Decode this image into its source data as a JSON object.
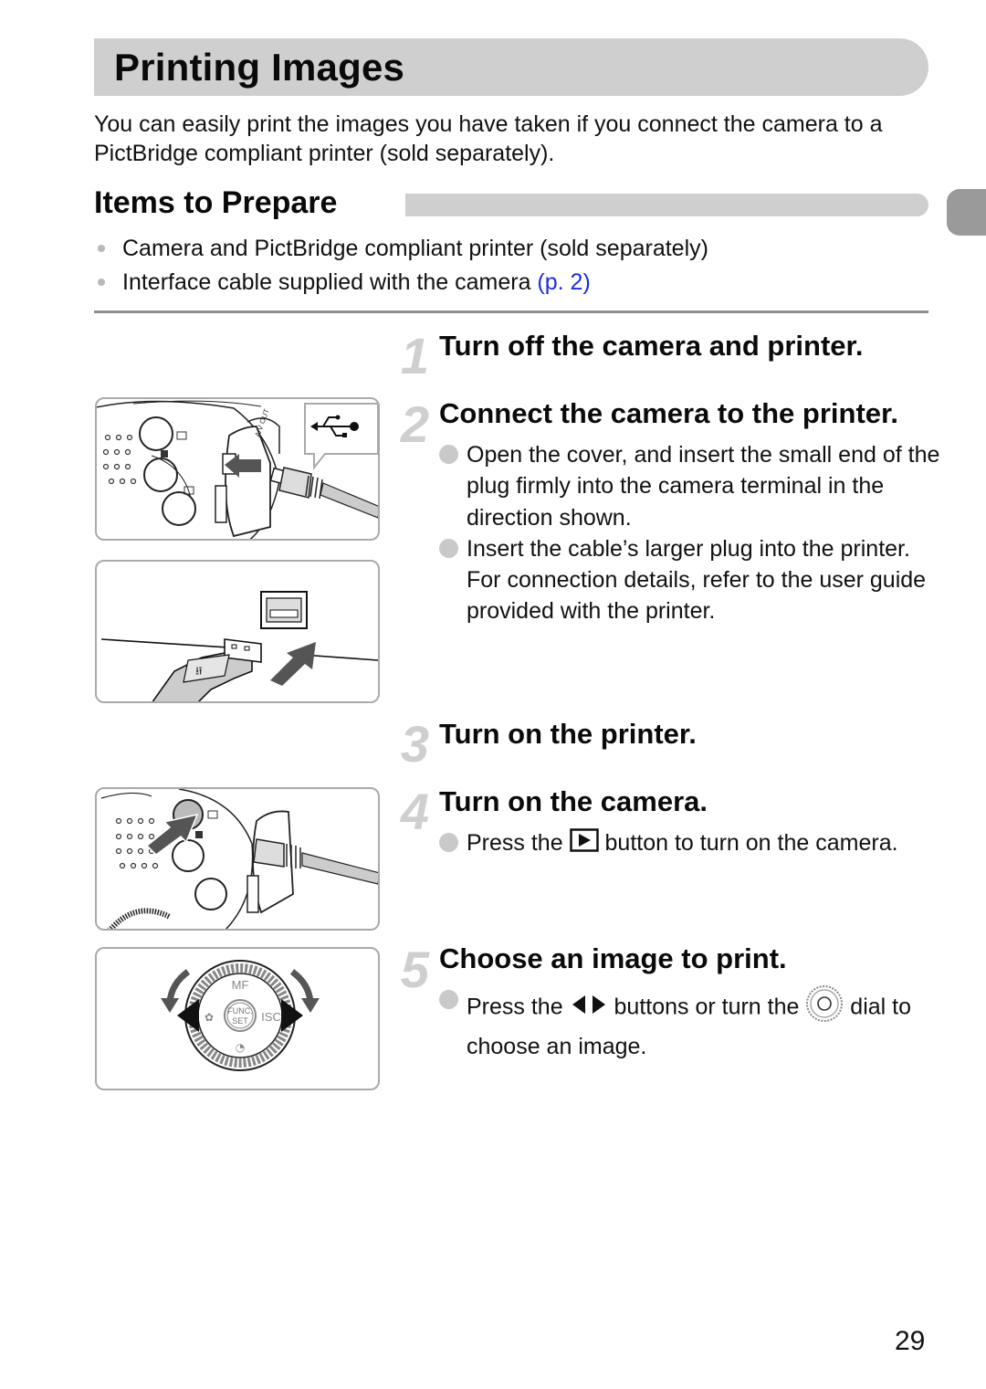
{
  "header": {
    "title": "Printing Images",
    "intro": "You can easily print the images you have taken if you connect the camera to a PictBridge compliant printer (sold separately)."
  },
  "items_to_prepare": {
    "heading": "Items to Prepare",
    "items": [
      {
        "text": "Camera and PictBridge compliant printer (sold separately)",
        "link": ""
      },
      {
        "text": "Interface cable supplied with the camera ",
        "link": "(p. 2)"
      }
    ]
  },
  "steps": [
    {
      "number": "1",
      "title": "Turn off the camera and printer.",
      "bullets": []
    },
    {
      "number": "2",
      "title": "Connect the camera to the printer.",
      "bullets": [
        "Open the cover, and insert the small end of the plug firmly into the camera terminal in the direction shown.",
        "Insert the cable’s larger plug into the printer. For connection details, refer to the user guide provided with the printer."
      ]
    },
    {
      "number": "3",
      "title": "Turn on the printer.",
      "bullets": []
    },
    {
      "number": "4",
      "title": "Turn on the camera.",
      "bullets": [
        {
          "before": "Press the ",
          "icon": "playback-button-icon",
          "after": " button to turn on the camera."
        }
      ]
    },
    {
      "number": "5",
      "title": "Choose an image to print.",
      "bullets": [
        {
          "before": "Press the ",
          "icon1": "left-right-arrows-icon",
          "middle": " buttons or turn the ",
          "icon2": "control-dial-icon",
          "after": " dial to choose an image."
        }
      ]
    }
  ],
  "figures": {
    "camera_terminal": {
      "label": "Camera USB terminal with plug insertion",
      "usb_symbol": "usb-icon",
      "terminal_label": "A/V OUT"
    },
    "printer_port": {
      "label": "USB plug into printer port"
    },
    "playback_button": {
      "label": "Press playback button"
    },
    "control_dial": {
      "label": "Control dial",
      "labels": {
        "top": "MF",
        "center_top": "FUNC.",
        "center_bottom": "SET",
        "right": "ISC"
      }
    }
  },
  "footer": {
    "page_number": "29"
  },
  "colors": {
    "title_bar": "#cfcfcf",
    "side_tab": "#9a9a9a",
    "link": "#1a2fd8",
    "step_number": "#cfcfcf",
    "bullet": "#c9c9c9"
  }
}
